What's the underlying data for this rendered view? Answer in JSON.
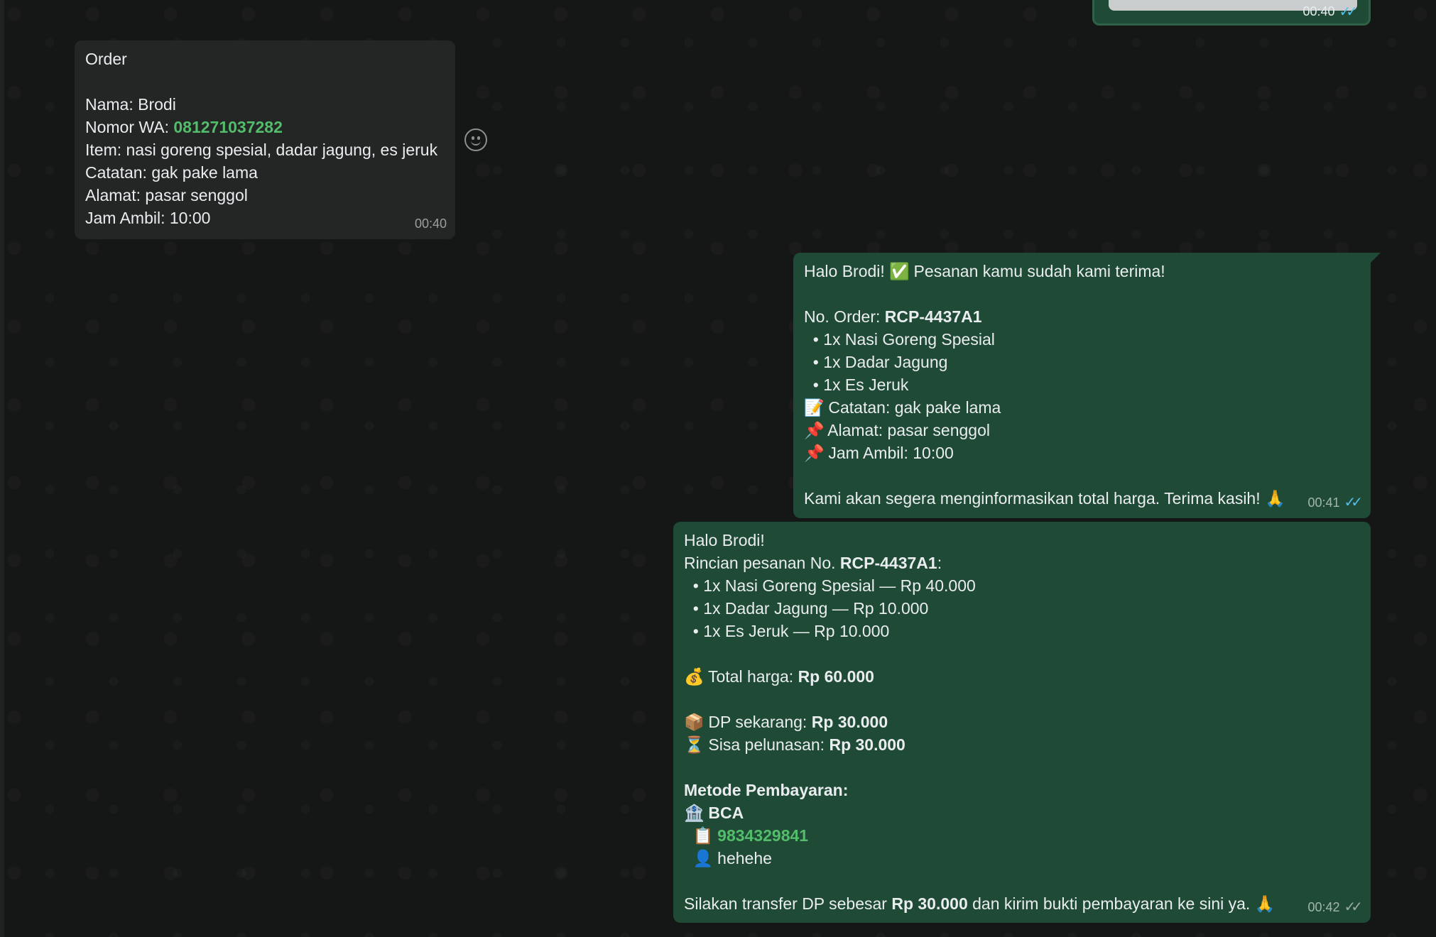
{
  "top_media": {
    "time": "00:40"
  },
  "incoming": {
    "lines": [
      "Order",
      "",
      "Nama: Brodi",
      "Nomor WA: ",
      "Item: nasi goreng spesial, dadar jagung, es jeruk",
      "Catatan: gak pake lama",
      "Alamat: pasar senggol",
      "Jam Ambil: 10:00"
    ],
    "phone": "081271037282",
    "time": "00:40"
  },
  "reply1": {
    "greeting": "Halo Brodi! ",
    "check_emoji": "✅",
    "greeting_rest": " Pesanan kamu sudah kami terima!",
    "order_label": "No. Order: ",
    "order_no": "RCP-4437A1",
    "items": [
      "1x Nasi Goreng Spesial",
      "1x Dadar Jagung",
      "1x Es Jeruk"
    ],
    "note_emoji": "📝",
    "note": " Catatan: gak pake lama",
    "pin_emoji": "📌",
    "address": " Alamat: pasar senggol",
    "pickup": " Jam Ambil: 10:00",
    "closing": "Kami akan segera menginformasikan total harga. Terima kasih! ",
    "pray_emoji": "🙏",
    "time": "00:41"
  },
  "reply2": {
    "greeting": "Halo Brodi!",
    "detail_label": "Rincian pesanan No. ",
    "order_no": "RCP-4437A1",
    "detail_colon": ":",
    "items": [
      "1x Nasi Goreng Spesial — Rp 40.000",
      "1x Dadar Jagung — Rp 10.000",
      "1x Es Jeruk — Rp 10.000"
    ],
    "money_emoji": "💰",
    "total_label": " Total harga: ",
    "total_value": "Rp 60.000",
    "box_emoji": "📦",
    "dp_label": " DP sekarang: ",
    "dp_value": "Rp 30.000",
    "hourglass_emoji": "⏳",
    "rest_label": " Sisa pelunasan: ",
    "rest_value": "Rp 30.000",
    "payment_heading": "Metode Pembayaran:",
    "bank_emoji": "🏦",
    "bank_name": "BCA",
    "clipboard_emoji": "📋",
    "account_no": "9834329841",
    "person_emoji": "👤",
    "account_name": "hehehe",
    "transfer_pre": "Silakan transfer DP sebesar ",
    "transfer_value": "Rp 30.000",
    "transfer_post": " dan kirim bukti pembayaran ke sini ya. ",
    "pray_emoji": "🙏",
    "time": "00:42"
  }
}
